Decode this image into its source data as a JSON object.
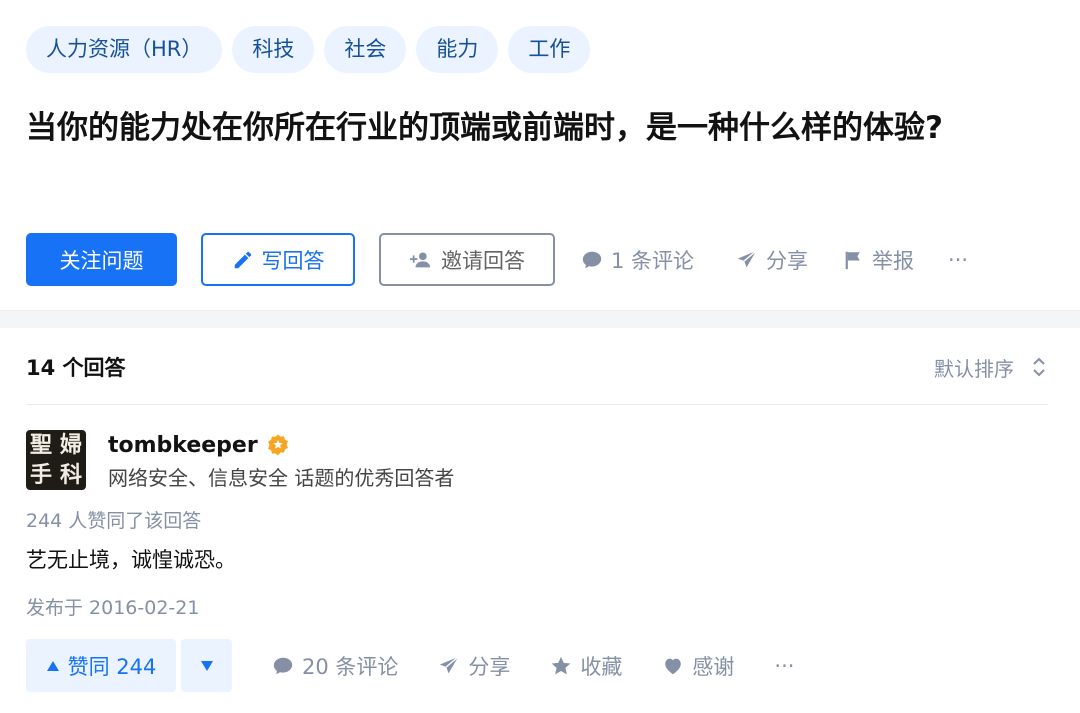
{
  "topics": [
    "人力资源（HR）",
    "科技",
    "社会",
    "能力",
    "工作"
  ],
  "question": {
    "title": "当你的能力处在你所在行业的顶端或前端时，是一种什么样的体验?"
  },
  "question_actions": {
    "follow": "关注问题",
    "write": "写回答",
    "invite": "邀请回答",
    "comments": "1 条评论",
    "share": "分享",
    "report": "举报",
    "more": "···"
  },
  "answers": {
    "count_label": "14 个回答",
    "sort_label": "默认排序"
  },
  "answer": {
    "avatar_chars": [
      "聖",
      "婦",
      "手",
      "科"
    ],
    "author_name": "tombkeeper",
    "author_bio": "网络安全、信息安全 话题的优秀回答者",
    "votes_line": "244 人赞同了该回答",
    "body": "艺无止境，诚惶诚恐。",
    "published": "发布于 2016-02-21",
    "actions": {
      "upvote": "赞同 244",
      "comments": "20 条评论",
      "share": "分享",
      "collect": "收藏",
      "thanks": "感谢",
      "more": "···"
    }
  },
  "colors": {
    "primary": "#1772f6",
    "tag_bg": "#eaf3ff",
    "tag_text": "#175199",
    "muted": "#8590a6",
    "badge": "#f5a623"
  }
}
